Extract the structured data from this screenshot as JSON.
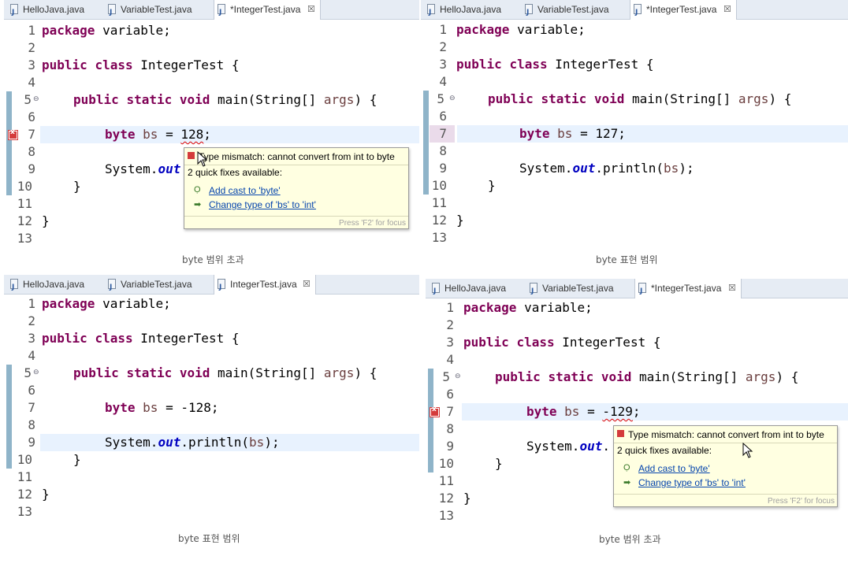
{
  "tabs": [
    "HelloJava.java",
    "VariableTest.java"
  ],
  "panels": [
    {
      "active_tab": "*IntegerTest.java",
      "line_numbers": [
        "1",
        "2",
        "3",
        "4",
        "5",
        "6",
        "7",
        "8",
        "9",
        "10",
        "11",
        "12",
        "13"
      ],
      "byte_value": "128",
      "caption": "byte 범위 초과",
      "error": true
    },
    {
      "active_tab": "*IntegerTest.java",
      "line_numbers": [
        "1",
        "2",
        "3",
        "4",
        "5",
        "6",
        "7",
        "8",
        "9",
        "10",
        "11",
        "12",
        "13"
      ],
      "byte_value": "127",
      "caption": "byte 표현 범위",
      "error": false
    },
    {
      "active_tab": "IntegerTest.java",
      "line_numbers": [
        "1",
        "2",
        "3",
        "4",
        "5",
        "6",
        "7",
        "8",
        "9",
        "10",
        "11",
        "12",
        "13"
      ],
      "byte_value": "-128",
      "caption": "byte 표현 범위",
      "error": false
    },
    {
      "active_tab": "*IntegerTest.java",
      "line_numbers": [
        "1",
        "2",
        "3",
        "4",
        "5",
        "6",
        "7",
        "8",
        "9",
        "10",
        "11",
        "12",
        "13"
      ],
      "byte_value": "-129",
      "caption": "byte 범위 초과",
      "error": true
    }
  ],
  "code": {
    "kw_package": "package",
    "package_name": " variable;",
    "kw_public": "public",
    "kw_class": "class",
    "class_name": " IntegerTest {",
    "kw_static": "static",
    "kw_void": "void",
    "main_sig": " main(String[] ",
    "args": "args",
    "main_end": ") {",
    "kw_byte": "byte",
    "var_bs": "bs",
    "assign": " = ",
    "semicolon": ";",
    "system": "System.",
    "out": "out",
    "println_open": ".println(",
    "println_close": ");",
    "close_brace": "}"
  },
  "popup": {
    "title": "Type mismatch: cannot convert from int to byte",
    "count": "2 quick fixes available:",
    "fix1": "Add cast to 'byte'",
    "fix2": "Change type of 'bs' to 'int'",
    "footer": "Press 'F2' for focus"
  }
}
